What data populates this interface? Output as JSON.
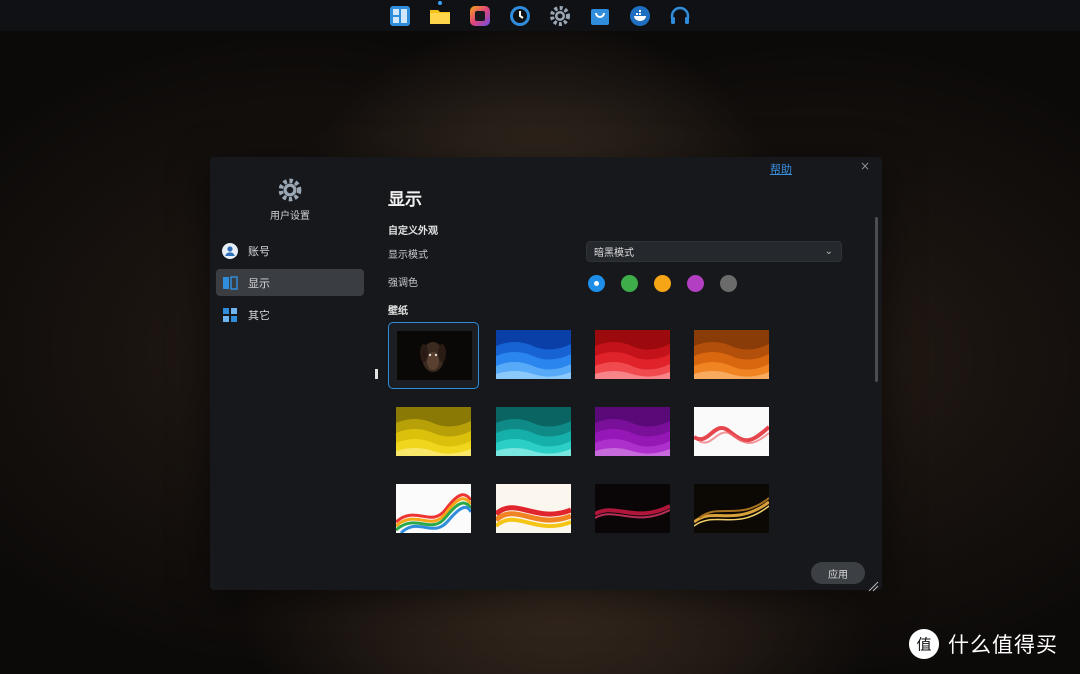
{
  "taskbar": {
    "apps": [
      {
        "name": "app-grid-icon",
        "color": "#2f8ddc"
      },
      {
        "name": "folder-icon",
        "color": "#f3c21b"
      },
      {
        "name": "media-icon",
        "color": "#c94ec4"
      },
      {
        "name": "clock-icon",
        "color": "#2f8ddc"
      },
      {
        "name": "settings-icon",
        "color": "#9aa7b5"
      },
      {
        "name": "store-icon",
        "color": "#2f8ddc"
      },
      {
        "name": "docker-icon",
        "color": "#2f8ddc"
      },
      {
        "name": "headset-icon",
        "color": "#2f8ddc"
      }
    ]
  },
  "window": {
    "help_label": "帮助",
    "close_label": "×",
    "sidebar": {
      "header_title": "用户设置",
      "items": [
        {
          "label": "账号",
          "icon": "account-icon"
        },
        {
          "label": "显示",
          "icon": "display-icon",
          "active": true
        },
        {
          "label": "其它",
          "icon": "other-icon"
        }
      ]
    },
    "content": {
      "page_title": "显示",
      "section_appearance": "自定义外观",
      "display_mode_label": "显示模式",
      "display_mode_value": "暗黑模式",
      "accent_label": "强调色",
      "accent_colors": [
        "#1e8fe8",
        "#3fae4a",
        "#f5a515",
        "#b23fc1",
        "#6b6b6b"
      ],
      "accent_selected": 0,
      "section_wallpaper": "壁纸",
      "wallpapers": [
        {
          "name": "wallpaper-dog",
          "selected": true
        },
        {
          "name": "wallpaper-blue-waves"
        },
        {
          "name": "wallpaper-red-waves"
        },
        {
          "name": "wallpaper-orange-waves"
        },
        {
          "name": "wallpaper-yellow-waves"
        },
        {
          "name": "wallpaper-teal-waves"
        },
        {
          "name": "wallpaper-purple-waves"
        },
        {
          "name": "wallpaper-red-smoke"
        },
        {
          "name": "wallpaper-rainbow-ribbon-1"
        },
        {
          "name": "wallpaper-rainbow-ribbon-2"
        },
        {
          "name": "wallpaper-dark-red-ribbon"
        },
        {
          "name": "wallpaper-gold-ribbon"
        }
      ],
      "apply_label": "应用"
    }
  },
  "watermark": {
    "text": "什么值得买",
    "logo_char": "值"
  }
}
